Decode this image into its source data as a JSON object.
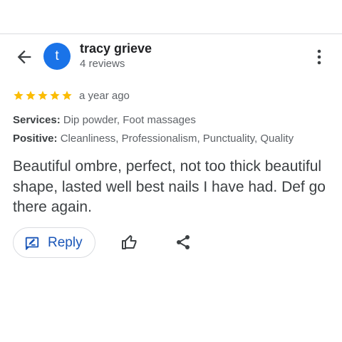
{
  "review": {
    "author": {
      "initial": "t",
      "name": "tracy grieve",
      "reviews_count": "4 reviews"
    },
    "rating": 5,
    "date": "a year ago",
    "services": {
      "label": "Services:",
      "value": "Dip powder, Foot massages"
    },
    "positive": {
      "label": "Positive:",
      "value": "Cleanliness, Professionalism, Punctuality, Quality"
    },
    "text": "Beautiful ombre, perfect, not too thick beautiful shape, lasted well best nails I have had. Def go there again."
  },
  "actions": {
    "reply_label": "Reply"
  },
  "icons": {
    "back": "arrow-back-icon",
    "more": "more-vert-icon",
    "reply": "reply-edit-icon",
    "like": "thumb-up-icon",
    "share": "share-icon"
  },
  "colors": {
    "avatar": "#1a73e8",
    "star": "#fbbc04",
    "reply_accent": "#1a56b8"
  }
}
